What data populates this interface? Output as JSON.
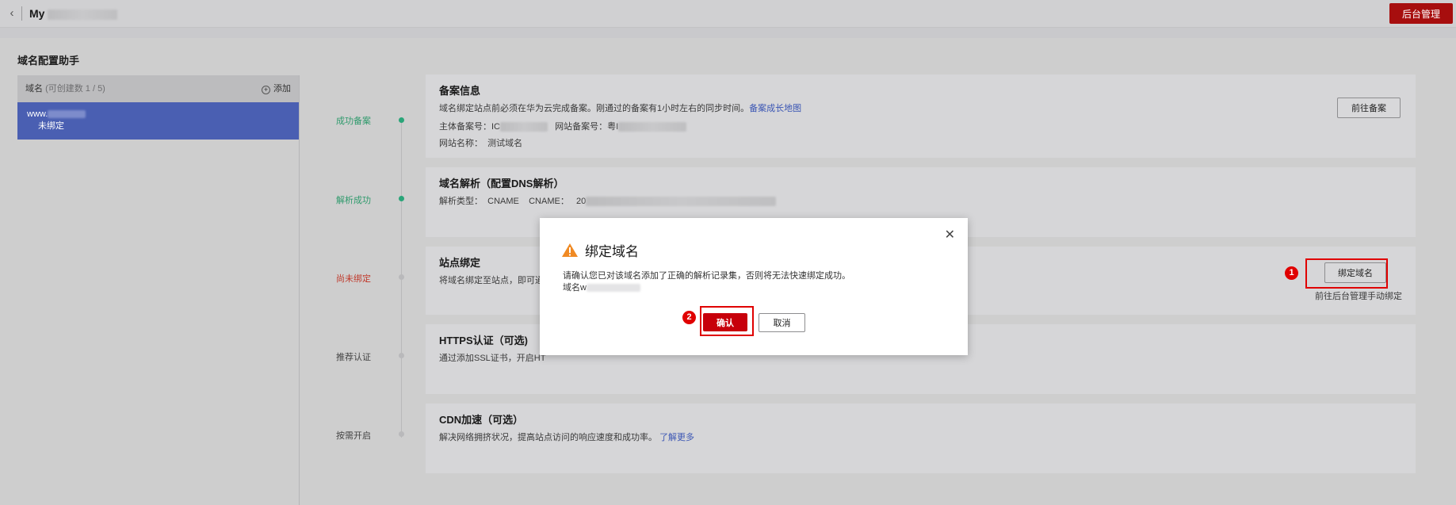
{
  "topbar": {
    "site_name": "My",
    "admin_button": "后台管理"
  },
  "panel": {
    "title": "域名配置助手"
  },
  "domain_list": {
    "header_label": "域名",
    "header_count": "(可创建数 1 / 5)",
    "add_label": "添加",
    "items": [
      {
        "domain_prefix": "www.",
        "status": "未绑定"
      }
    ]
  },
  "steps": [
    {
      "status": "成功备案",
      "state": "success"
    },
    {
      "status": "解析成功",
      "state": "success"
    },
    {
      "status": "尚未绑定",
      "state": "pending"
    },
    {
      "status": "推荐认证",
      "state": "optional"
    },
    {
      "status": "按需开启",
      "state": "optional"
    }
  ],
  "cards": {
    "filing": {
      "title": "备案信息",
      "desc": "域名绑定站点前必须在华为云完成备案。刚通过的备案有1小时左右的同步时间。",
      "link": "备案成长地图",
      "subject_label": "主体备案号：",
      "subject_value": "IC",
      "site_label": "网站备案号：",
      "site_value": "粤I",
      "sitename_label": "网站名称：",
      "sitename_value": "测试域名",
      "button": "前往备案"
    },
    "dns": {
      "title": "域名解析（配置DNS解析）",
      "type_label": "解析类型：",
      "type_value": "CNAME",
      "cname_label": "CNAME：",
      "cname_value": "20"
    },
    "binding": {
      "title": "站点绑定",
      "desc": "将域名绑定至站点，即可通",
      "button": "绑定域名",
      "manual_link": "前往后台管理手动绑定"
    },
    "https": {
      "title": "HTTPS认证（可选)",
      "desc": "通过添加SSL证书，开启HT"
    },
    "cdn": {
      "title": "CDN加速（可选）",
      "desc": "解决网络拥挤状况，提高站点访问的响应速度和成功率。",
      "link": "了解更多"
    }
  },
  "dialog": {
    "title": "绑定域名",
    "message": "请确认您已对该域名添加了正确的解析记录集，否则将无法快速绑定成功。",
    "domain_label": "域名w",
    "confirm": "确认",
    "cancel": "取消"
  },
  "annotations": {
    "badge1": "1",
    "badge2": "2"
  },
  "colors": {
    "brand_red": "#c7000b",
    "success_green": "#2aa579",
    "selected_item": "#4a5fb2",
    "link_blue": "#3b56b4"
  }
}
